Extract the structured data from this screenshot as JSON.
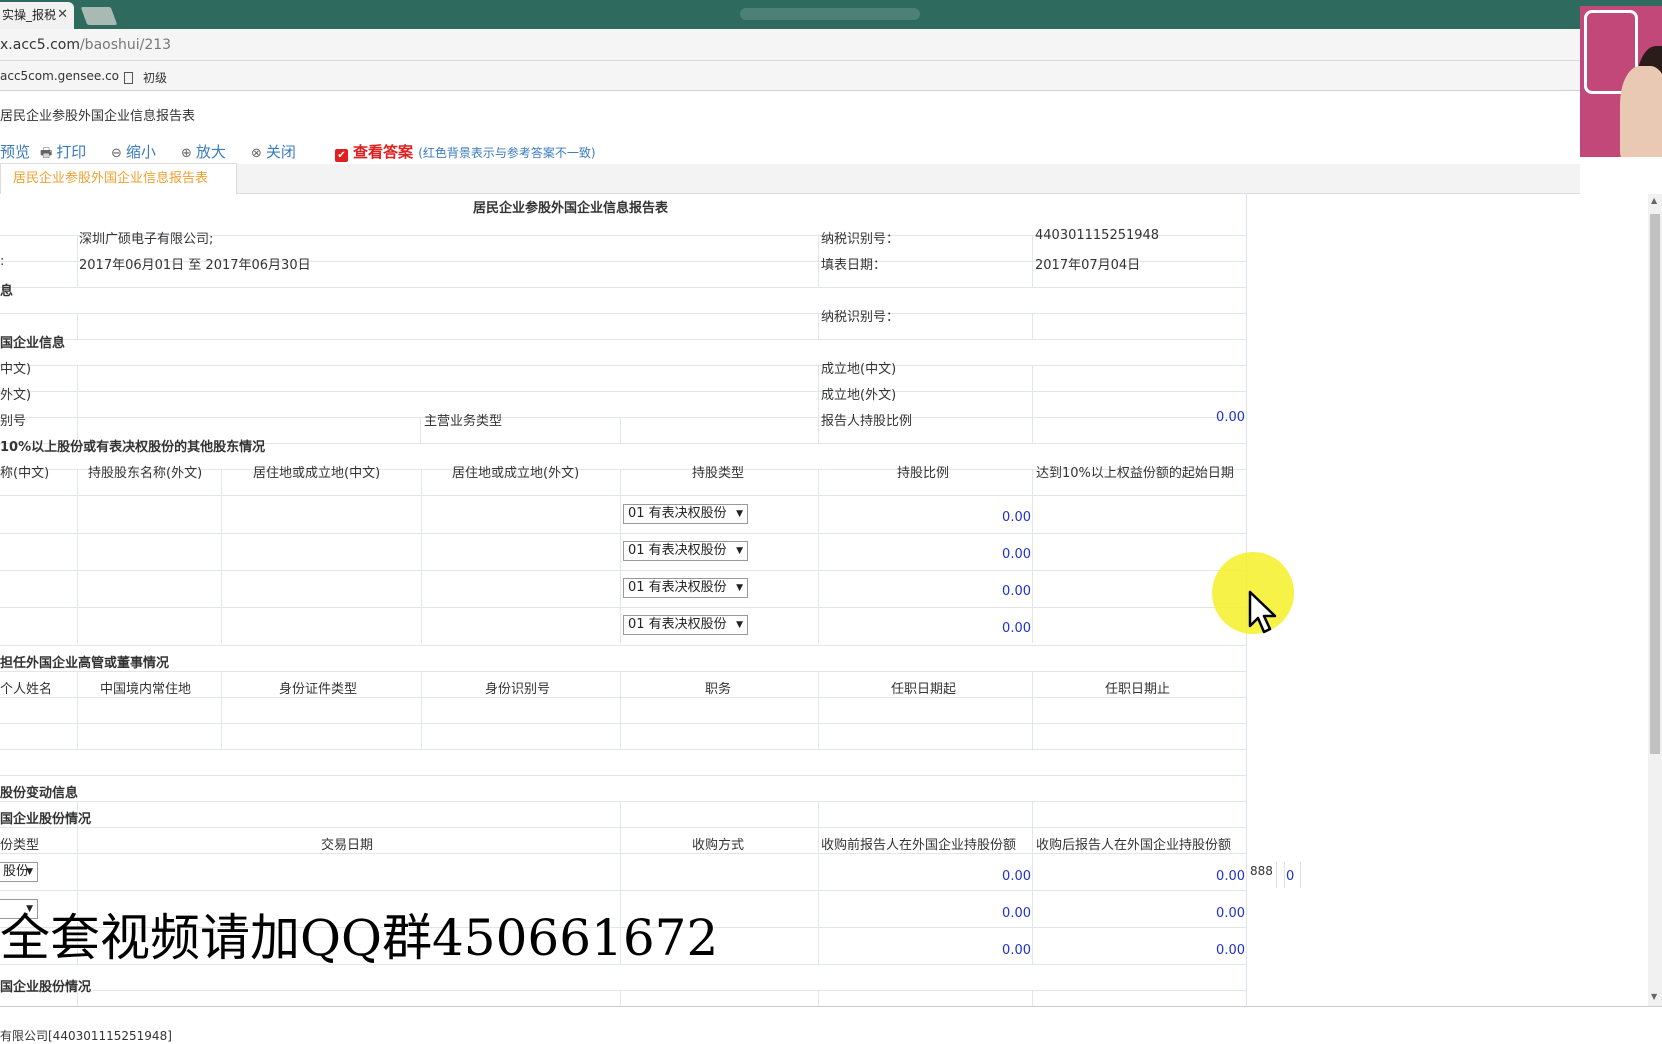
{
  "browser": {
    "tab_title": "实操_报税",
    "url_host": "x.acc5.com",
    "url_path": "/baoshui/213",
    "bookmarks": [
      "acc5com.gensee.co",
      "初级"
    ]
  },
  "page": {
    "title": "居民企业参股外国企业信息报告表",
    "toolbar": {
      "preview": "预览",
      "print": "打印",
      "zoom_out": "缩小",
      "zoom_in": "放大",
      "close": "关闭",
      "check_answer": "查看答案",
      "check_note": "(红色背景表示与参考答案不一致)"
    },
    "sheet_tab": "居民企业参股外国企业信息报告表"
  },
  "form": {
    "heading": "居民企业参股外国企业信息报告表",
    "company_name": "深圳广硕电子有限公司;",
    "taxpayer_id_label": "纳税识别号：",
    "taxpayer_id": "440301115251948",
    "period": "2017年06月01日 至 2017年06月30日",
    "fill_date_label": "填表日期：",
    "fill_date": "2017年07月04日",
    "row_colon": ":",
    "section1": "息",
    "taxpayer_id_label2": "纳税识别号：",
    "section2": "国企业信息",
    "name_cn": "中文)",
    "name_en": "外文)",
    "reg_loc_cn": "成立地(中文)",
    "reg_no": "别号",
    "reg_loc_en": "成立地(外文)",
    "business_type": "主营业务类型",
    "holding_ratio_label": "报告人持股比例",
    "holding_ratio": "0.00",
    "section3": "10%以上股份或有表决权股份的其他股东情况",
    "sh_headers": [
      "称(中文)",
      "持股股东名称(外文)",
      "居住地或成立地(中文)",
      "居住地或成立地(外文)",
      "持股类型",
      "持股比例",
      "达到10%以上权益份额的起始日期"
    ],
    "sh_rows": [
      {
        "type": "01 有表决权股份",
        "ratio": "0.00"
      },
      {
        "type": "01 有表决权股份",
        "ratio": "0.00"
      },
      {
        "type": "01 有表决权股份",
        "ratio": "0.00"
      },
      {
        "type": "01 有表决权股份",
        "ratio": "0.00"
      }
    ],
    "section4": "担任外国企业高管或董事情况",
    "dir_headers": [
      "个人姓名",
      "中国境内常住地",
      "身份证件类型",
      "身份识别号",
      "职务",
      "任职日期起",
      "任职日期止"
    ],
    "section5": "股份变动信息",
    "section6": "国企业股份情况",
    "acq_headers": [
      "份类型",
      "交易日期",
      "收购方式",
      "收购前报告人在外国企业持股份额",
      "收购后报告人在外国企业持股份额"
    ],
    "acq_rows": [
      {
        "type": "股份",
        "before": "0.00",
        "after": "0.00"
      },
      {
        "type": "",
        "before": "0.00",
        "after": "0.00"
      },
      {
        "type": "",
        "before": "0.00",
        "after": "0.00"
      }
    ],
    "extra_888": "888",
    "extra_0": "0",
    "section7": "国企业股份情况"
  },
  "status": {
    "text": "有限公司[440301115251948]"
  },
  "overlay": {
    "watermark": "全套视频请加QQ群450661672"
  }
}
